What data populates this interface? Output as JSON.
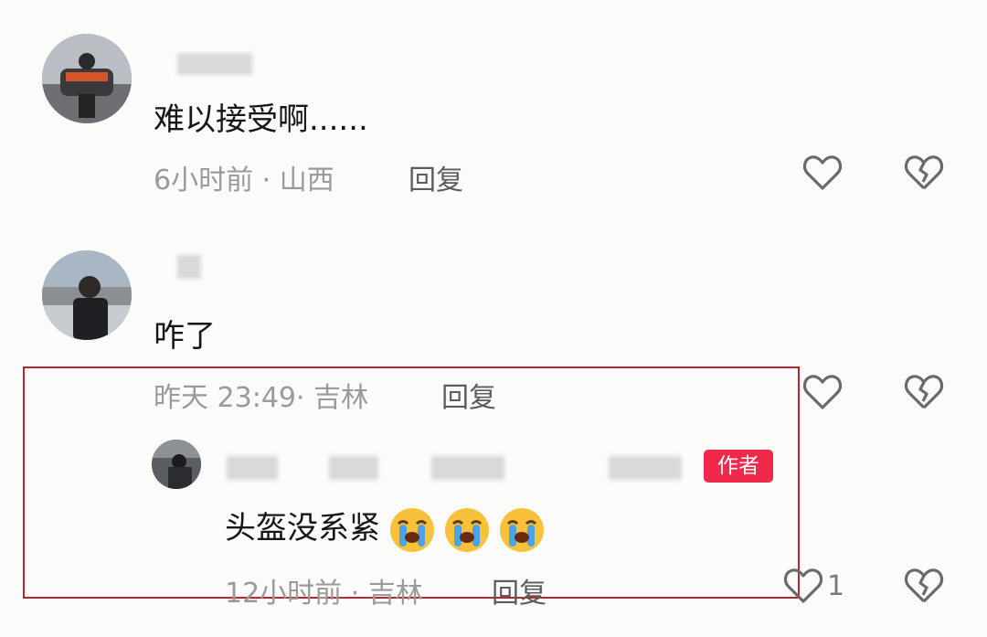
{
  "comments": [
    {
      "text": "难以接受啊......",
      "meta": "6小时前 · 山西",
      "reply_label": "回复"
    },
    {
      "text": "咋了",
      "meta": "昨天 23:49· 吉林",
      "reply_label": "回复",
      "reply": {
        "badge": "作者",
        "text": "头盔没系紧",
        "emoji": [
          "loudly-crying-face",
          "loudly-crying-face",
          "loudly-crying-face"
        ],
        "meta": "12小时前 · 吉林",
        "reply_label": "回复",
        "like_count": "1"
      }
    }
  ],
  "colors": {
    "highlight_border": "#b8282a",
    "author_badge": "#f0284a",
    "meta_text": "#9a9a9a"
  },
  "icons": [
    "heart-outline-icon",
    "broken-heart-icon",
    "loudly-crying-face-emoji"
  ]
}
